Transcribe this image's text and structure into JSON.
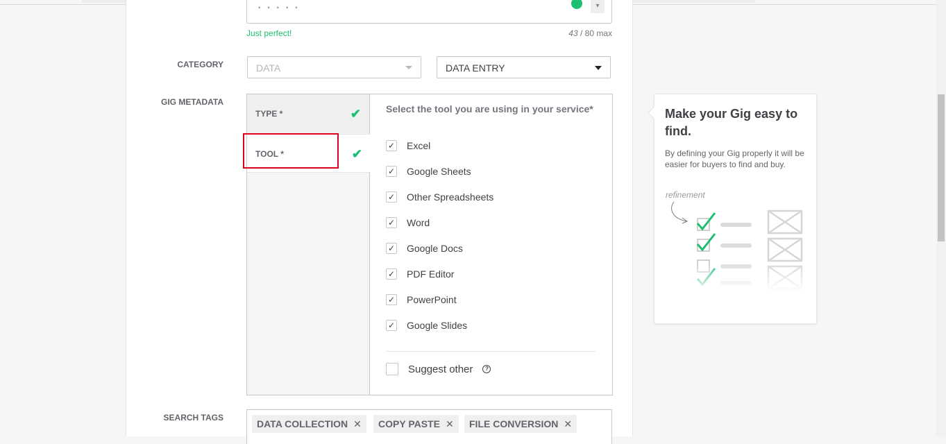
{
  "title_field": {
    "hint": "Just perfect!",
    "count_current": "43",
    "count_max": " / 80 max"
  },
  "category": {
    "label": "CATEGORY",
    "main_value": "DATA",
    "sub_value": "DATA ENTRY"
  },
  "metadata": {
    "label": "GIG METADATA",
    "tabs": [
      {
        "label": "TYPE *",
        "done": true
      },
      {
        "label": "TOOL *",
        "done": true
      }
    ],
    "question": "Select the tool you are using in your service*",
    "options": [
      {
        "label": "Excel",
        "checked": true
      },
      {
        "label": "Google Sheets",
        "checked": true
      },
      {
        "label": "Other Spreadsheets",
        "checked": true
      },
      {
        "label": "Word",
        "checked": true
      },
      {
        "label": "Google Docs",
        "checked": true
      },
      {
        "label": "PDF Editor",
        "checked": true
      },
      {
        "label": "PowerPoint",
        "checked": true
      },
      {
        "label": "Google Slides",
        "checked": true
      }
    ],
    "suggest_label": "Suggest other",
    "help_glyph": "?",
    "check_glyph": "✓",
    "tab_check_glyph": "✔"
  },
  "search_tags": {
    "label": "SEARCH TAGS",
    "tags": [
      "DATA COLLECTION",
      "COPY PASTE",
      "FILE CONVERSION"
    ],
    "remove_glyph": "✕"
  },
  "tip": {
    "title": "Make your Gig easy to find.",
    "text": "By defining your Gig properly it will be easier for buyers to find and buy.",
    "illustration_label": "refinement"
  },
  "colors": {
    "accent_green": "#1dbf73",
    "highlight_red": "#e0001b"
  }
}
